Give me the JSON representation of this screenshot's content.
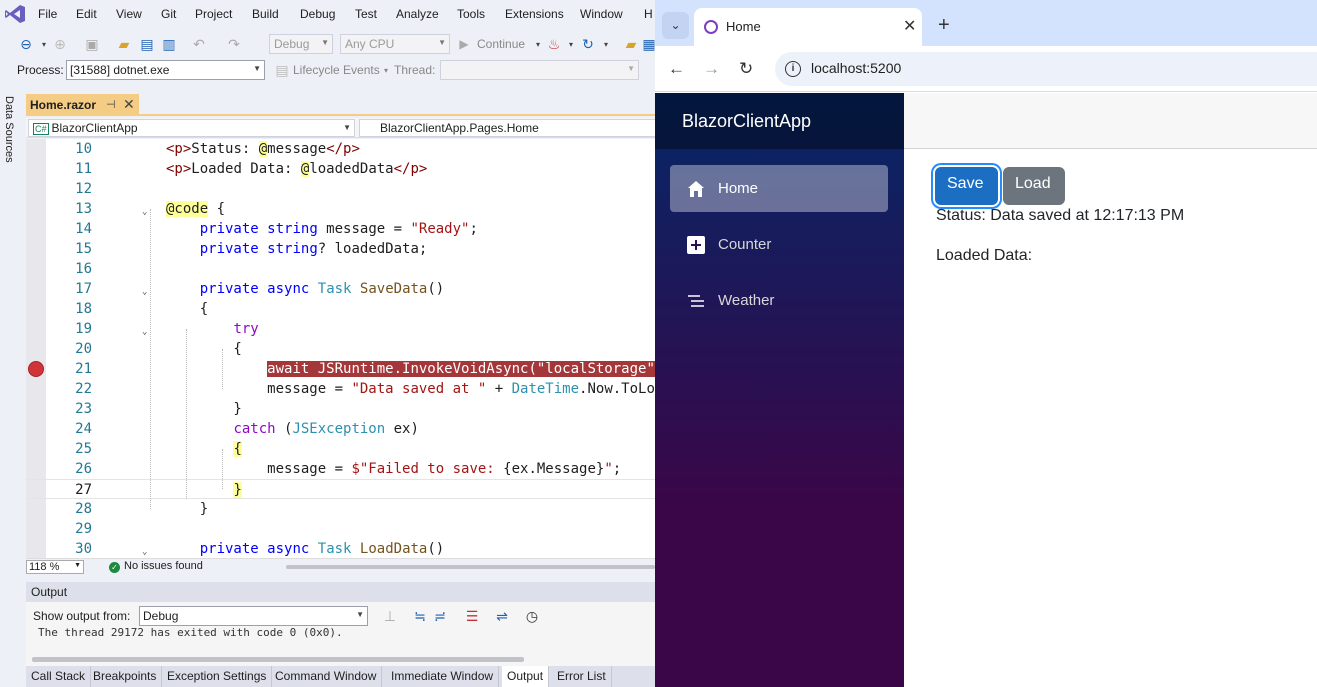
{
  "vs": {
    "menu": [
      "File",
      "Edit",
      "View",
      "Git",
      "Project",
      "Build",
      "Debug",
      "Test",
      "Analyze",
      "Tools",
      "Extensions",
      "Window",
      "H"
    ],
    "toolbar": {
      "config": "Debug",
      "platform": "Any CPU",
      "continue_label": "Continue"
    },
    "debug_bar": {
      "process_label": "Process:",
      "process_value": "[31588] dotnet.exe",
      "lifecycle_label": "Lifecycle Events",
      "thread_label": "Thread:"
    },
    "side_panel": "Data Sources",
    "doc_tab": {
      "title": "Home.razor",
      "pin": "⊣",
      "close": "✕"
    },
    "nav": {
      "project": "BlazorClientApp",
      "scope": "BlazorClientApp.Pages.Home"
    },
    "code_lines": [
      {
        "num": "10",
        "fold": "",
        "html": "<span class=\"tg\">&lt;p&gt;</span>Status: <span class=\"rz\">@</span>message<span class=\"tg\">&lt;/p&gt;</span>"
      },
      {
        "num": "11",
        "fold": "",
        "html": "<span class=\"tg\">&lt;p&gt;</span>Loaded Data: <span class=\"rz\">@</span>loadedData<span class=\"tg\">&lt;/p&gt;</span>"
      },
      {
        "num": "12",
        "fold": "",
        "html": ""
      },
      {
        "num": "13",
        "fold": "⌄",
        "html": "<span class=\"rz\">@code</span> {"
      },
      {
        "num": "14",
        "fold": "",
        "html": "    <span class=\"kw\">private</span> <span class=\"kw\">string</span> message = <span class=\"st\">\"Ready\"</span>;"
      },
      {
        "num": "15",
        "fold": "",
        "html": "    <span class=\"kw\">private</span> <span class=\"kw\">string</span>? loadedData;"
      },
      {
        "num": "16",
        "fold": "",
        "html": ""
      },
      {
        "num": "17",
        "fold": "⌄",
        "html": "    <span class=\"kw\">private</span> <span class=\"kw\">async</span> <span class=\"ty\">Task</span> <span class=\"mt\">SaveData</span>()"
      },
      {
        "num": "18",
        "fold": "",
        "html": "    {"
      },
      {
        "num": "19",
        "fold": "⌄",
        "html": "        <span class=\"fl\">try</span>"
      },
      {
        "num": "20",
        "fold": "",
        "html": "        {"
      },
      {
        "num": "21",
        "fold": "",
        "html": "            <span class=\"hl\">await JSRuntime.InvokeVoidAsync(\"localStorage\"</span>"
      },
      {
        "num": "22",
        "fold": "",
        "html": "            message = <span class=\"st\">\"Data saved at \"</span> + <span class=\"ty\">DateTime</span>.Now.ToLongTimeString();"
      },
      {
        "num": "23",
        "fold": "",
        "html": "        }"
      },
      {
        "num": "24",
        "fold": "",
        "html": "        <span class=\"fl\">catch</span> (<span class=\"ty\">JSException</span> ex)"
      },
      {
        "num": "25",
        "fold": "",
        "html": "        <span class=\"rz\">{</span>"
      },
      {
        "num": "26",
        "fold": "",
        "html": "            message = <span class=\"st\">$\"Failed to save: </span>{ex.Message}<span class=\"st\">\"</span>;"
      },
      {
        "num": "27",
        "fold": "",
        "html": "        <span class=\"rz\">}</span>"
      },
      {
        "num": "28",
        "fold": "",
        "html": "    }"
      },
      {
        "num": "29",
        "fold": "",
        "html": ""
      },
      {
        "num": "30",
        "fold": "⌄",
        "html": "    <span class=\"kw\">private</span> <span class=\"kw\">async</span> <span class=\"ty\">Task</span> <span class=\"mt\">LoadData</span>()"
      }
    ],
    "breakpoint_line": "21",
    "current_line": "27",
    "zoom": "118 %",
    "issues": "No issues found",
    "output": {
      "title": "Output",
      "show_from_label": "Show output from:",
      "source": "Debug",
      "text": "The thread 29172 has exited with code 0 (0x0)."
    },
    "bottom_tabs": [
      "Call Stack",
      "Breakpoints",
      "Exception Settings",
      "Command Window",
      "Immediate Window",
      "Output",
      "Error List"
    ],
    "active_bottom_tab": "Output"
  },
  "browser": {
    "tab_title": "Home",
    "url": "localhost:5200",
    "app": {
      "brand": "BlazorClientApp",
      "nav": [
        {
          "label": "Home",
          "icon": "home-icon",
          "active": true
        },
        {
          "label": "Counter",
          "icon": "plus-square-icon",
          "active": false
        },
        {
          "label": "Weather",
          "icon": "list-icon",
          "active": false
        }
      ],
      "save_label": "Save",
      "load_label": "Load",
      "status_text": "Status: Data saved at 12:17:13 PM",
      "loaded_text": "Loaded Data:"
    }
  }
}
